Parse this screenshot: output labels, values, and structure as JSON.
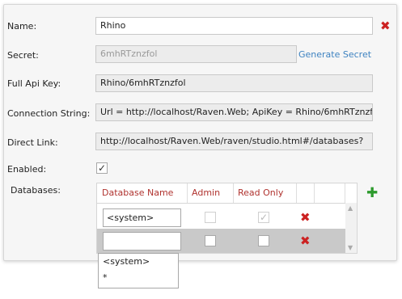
{
  "form": {
    "name": {
      "label": "Name:",
      "value": "Rhino"
    },
    "secret": {
      "label": "Secret:",
      "value": "6mhRTznzfol",
      "action": "Generate Secret"
    },
    "full_api_key": {
      "label": "Full Api Key:",
      "value": "Rhino/6mhRTznzfol"
    },
    "connection_string": {
      "label": "Connection String:",
      "value": "Url = http://localhost/Raven.Web; ApiKey = Rhino/6mhRTznzfol"
    },
    "direct_link": {
      "label": "Direct Link:",
      "value": "http://localhost/Raven.Web/raven/studio.html#/databases?"
    },
    "enabled": {
      "label": "Enabled:",
      "checked": true
    },
    "databases_label": "Databases:"
  },
  "databases_grid": {
    "columns": [
      "Database Name",
      "Admin",
      "Read Only"
    ],
    "rows": [
      {
        "database_name": "<system>",
        "admin": false,
        "read_only": true,
        "selected": false
      },
      {
        "database_name": "",
        "admin": false,
        "read_only": false,
        "selected": true
      }
    ]
  },
  "dropdown": {
    "options": [
      "<system>",
      "*"
    ]
  },
  "icons": {
    "delete": "delete-x-icon",
    "add": "add-plus-icon",
    "check": "checkmark-icon"
  },
  "colors": {
    "header_text": "#b0332f",
    "link": "#3f83c1",
    "delete": "#cc2222",
    "add": "#2c9a2c",
    "selected_row": "#c9c9c9"
  }
}
